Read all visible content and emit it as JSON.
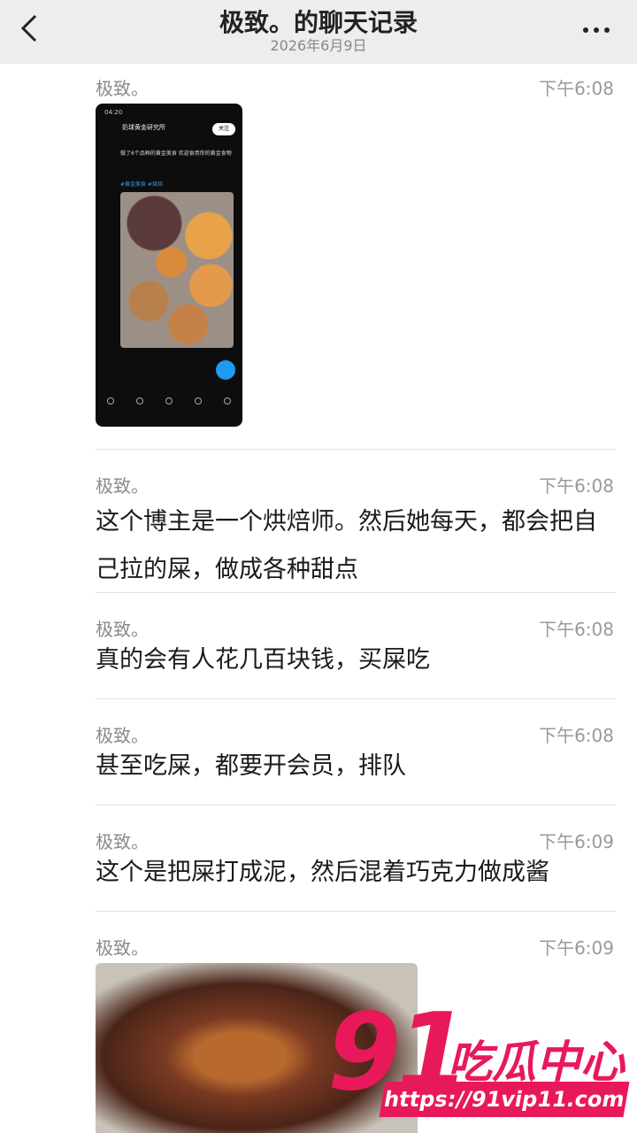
{
  "header": {
    "title": "极致。的聊天记录",
    "date": "2026年6月9日"
  },
  "thumbnail": {
    "status_time": "04:20",
    "account": "奶球黄金研究所",
    "follow": "关注",
    "post_text": "做了6个品种的黄金美食 欢迎食用你的黄金食物",
    "tags": "#黄金美食 #烘焙"
  },
  "messages": [
    {
      "sender": "极致。",
      "time": "下午6:08",
      "text": ""
    },
    {
      "sender": "极致。",
      "time": "下午6:08",
      "text": "这个博主是一个烘焙师。然后她每天，都会把自己拉的屎，做成各种甜点"
    },
    {
      "sender": "极致。",
      "time": "下午6:08",
      "text": "真的会有人花几百块钱，买屎吃"
    },
    {
      "sender": "极致。",
      "time": "下午6:08",
      "text": "甚至吃屎，都要开会员，排队"
    },
    {
      "sender": "极致。",
      "time": "下午6:09",
      "text": "这个是把屎打成泥，然后混着巧克力做成酱"
    },
    {
      "sender": "极致。",
      "time": "下午6:09",
      "text": ""
    }
  ],
  "watermark": {
    "number": "91",
    "name": "吃瓜中心",
    "url": "https://91vip11.com"
  },
  "colors": {
    "accent": "#e8195a",
    "header_bg": "#ededed"
  }
}
